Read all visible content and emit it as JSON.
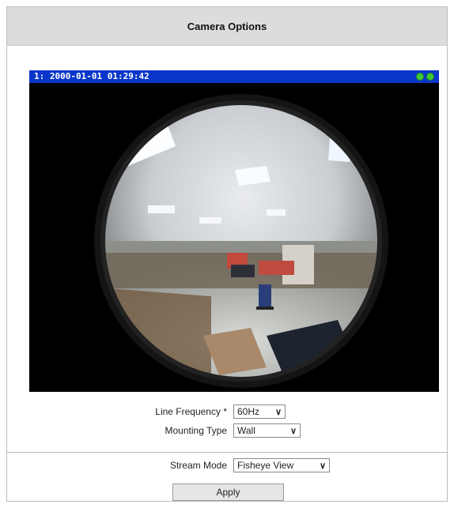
{
  "title": "Camera Options",
  "video": {
    "overlay_text": "1:  2000-01-01 01:29:42",
    "status_icons": [
      "status-icon",
      "status-icon"
    ]
  },
  "form": {
    "line_frequency": {
      "label": "Line Frequency *",
      "value": "60Hz"
    },
    "mounting_type": {
      "label": "Mounting Type",
      "value": "Wall"
    },
    "stream_mode": {
      "label": "Stream Mode",
      "value": "Fisheye View"
    }
  },
  "apply_label": "Apply",
  "colors": {
    "overlay_bar": "#0a37c9",
    "status_green": "#3ecb3a",
    "title_bg": "#dcdcdc"
  }
}
